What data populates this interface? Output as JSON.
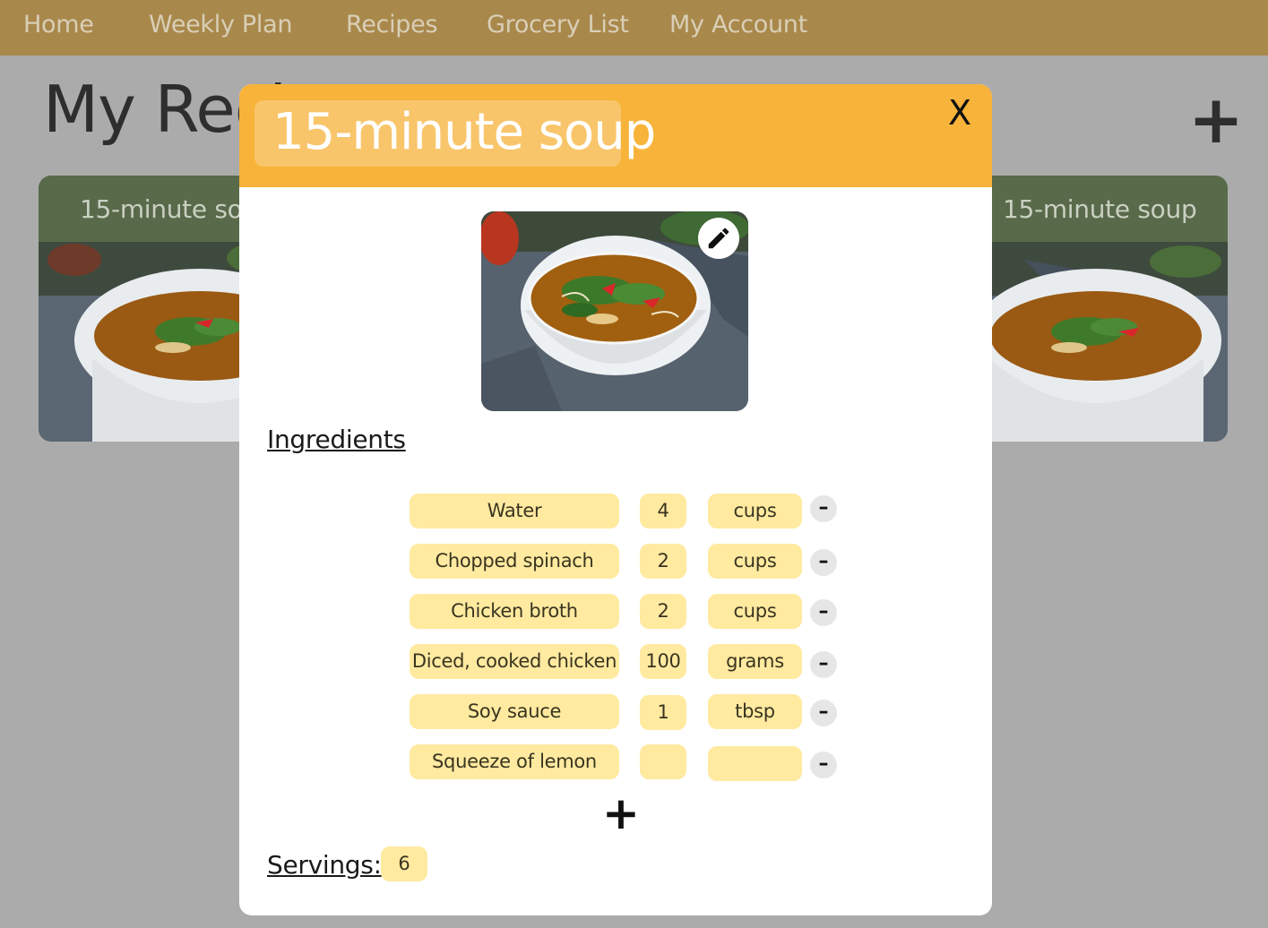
{
  "nav": {
    "items": [
      {
        "label": "Home"
      },
      {
        "label": "Weekly Plan"
      },
      {
        "label": "Recipes"
      },
      {
        "label": "Grocery List"
      },
      {
        "label": "My Account"
      }
    ],
    "bar_color": "#a9884b"
  },
  "page": {
    "title": "My Recipes",
    "add_button": "+"
  },
  "recipe_cards": [
    {
      "title": "15-minute soup",
      "image": "soup-photo"
    },
    {
      "title": "15-minute soup",
      "image": "soup-photo"
    }
  ],
  "modal": {
    "title": "15-minute soup",
    "close_label": "X",
    "photo": "soup-photo",
    "edit_icon": "pencil-icon",
    "ingredients_heading": "Ingredients",
    "ingredients": [
      {
        "name": "Water",
        "quantity": "4",
        "unit": "cups"
      },
      {
        "name": "Chopped spinach",
        "quantity": "2",
        "unit": "cups"
      },
      {
        "name": "Chicken broth",
        "quantity": "2",
        "unit": "cups"
      },
      {
        "name": "Diced, cooked chicken",
        "quantity": "100",
        "unit": "grams"
      },
      {
        "name": "Soy sauce",
        "quantity": "1",
        "unit": "tbsp"
      },
      {
        "name": "Squeeze of lemon",
        "quantity": "",
        "unit": ""
      }
    ],
    "remove_label": "–",
    "add_ingredient_label": "+",
    "servings_label": "Servings:",
    "servings_value": "6",
    "header_color": "#f7b33a",
    "field_color": "#ffeaa0"
  }
}
